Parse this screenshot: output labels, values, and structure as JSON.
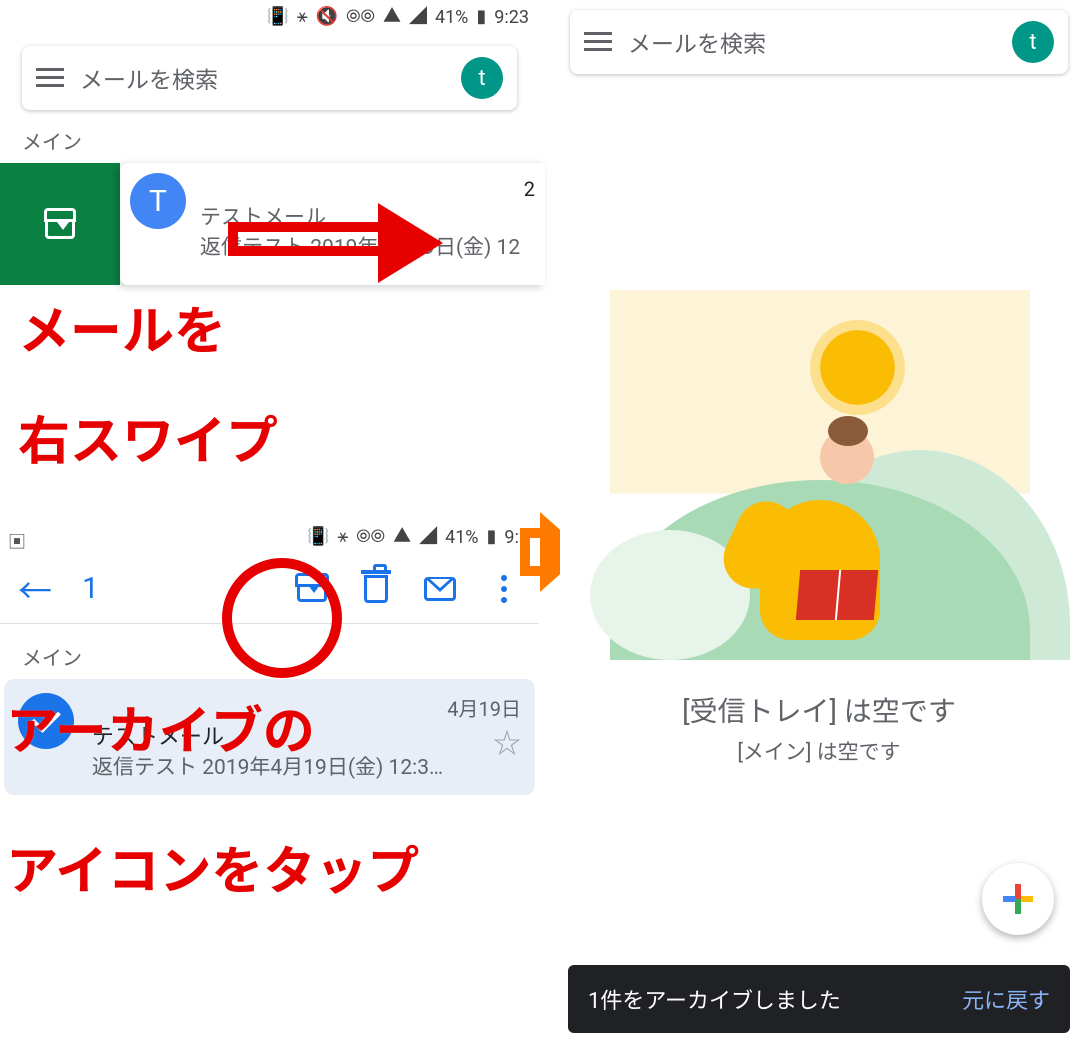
{
  "status": {
    "battery": "41%",
    "time": "9:23",
    "time2": "9:2"
  },
  "search": {
    "placeholder": "メールを検索",
    "avatar_letter": "t"
  },
  "section_main": "メイン",
  "mail1": {
    "avatar_letter": "T",
    "count": "2",
    "subject": "テストメール",
    "preview": "返信テスト 2019年4月19日(金) 12"
  },
  "annotation1_line1": "メールを",
  "annotation1_line2": "右スワイプ",
  "selection": {
    "count": "1",
    "section": "メイン",
    "date": "4月19日",
    "subject": "テストメール",
    "preview": "返信テスト 2019年4月19日(金) 12:38..."
  },
  "annotation2_line1": "アーカイブの",
  "annotation2_line2": "アイコンをタップ",
  "empty": {
    "line1": "[受信トレイ] は空です",
    "line2": "[メイン] は空です"
  },
  "snackbar": {
    "message": "1件をアーカイブしました",
    "undo": "元に戻す"
  }
}
